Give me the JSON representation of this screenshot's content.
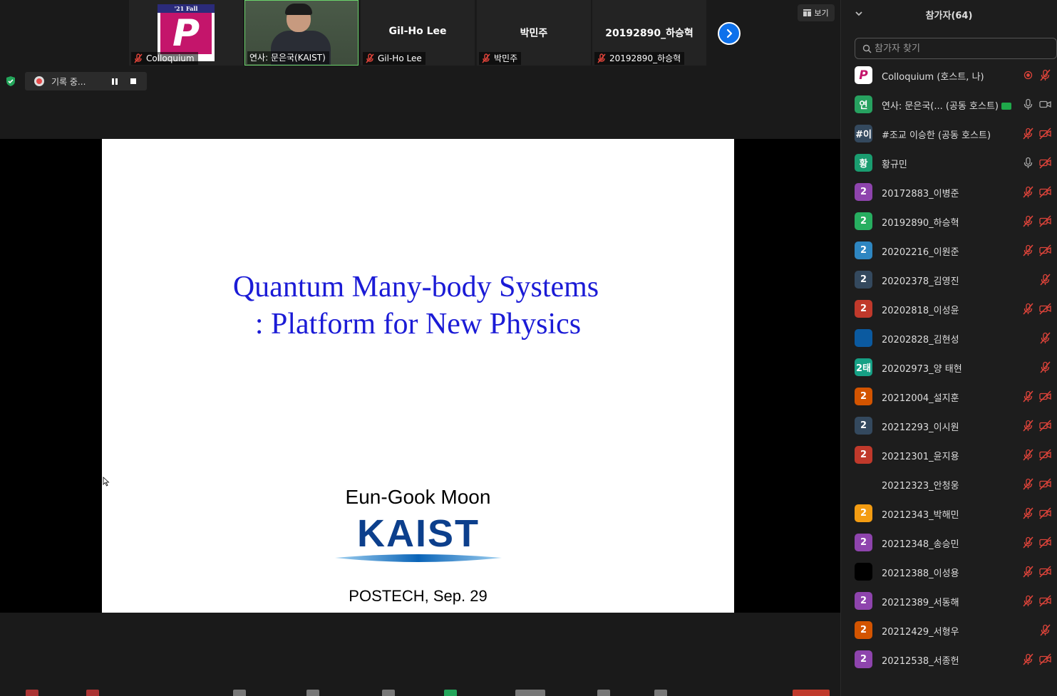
{
  "top_strip": {
    "tiles": [
      {
        "kind": "logo",
        "label": "Colloquium",
        "logo_top_text": "'21 Fall Colloquium",
        "logo_letter": "P"
      },
      {
        "kind": "video",
        "label": "연사: 문은국(KAIST)"
      },
      {
        "kind": "name",
        "name": "Gil-Ho Lee",
        "label": "Gil-Ho Lee"
      },
      {
        "kind": "name",
        "name": "박민주",
        "label": "박민주"
      },
      {
        "kind": "name",
        "name": "20192890_하승혁",
        "label": "20192890_하승혁"
      }
    ],
    "view_button_label": "보기"
  },
  "recording": {
    "label": "기록 중..."
  },
  "slide": {
    "title_line1": "Quantum Many-body Systems",
    "title_line2": ": Platform for New Physics",
    "author": "Eun-Gook Moon",
    "institution_logo_text": "KAIST",
    "venue": "POSTECH, Sep. 29"
  },
  "panel": {
    "title": "참가자(64)",
    "search_placeholder": "참가자 찾기",
    "participants": [
      {
        "name": "Colloquium (호스트, 나)",
        "avatar_text": "P",
        "avatar_color": "#ffffff",
        "icon_a": "record-icon",
        "icon_b": "mic-muted-icon",
        "avatar_kind": "logo"
      },
      {
        "name": "연사: 문은국(...  (공동 호스트)",
        "avatar_text": "연",
        "avatar_color": "#27a160",
        "icon_a": "mic-icon",
        "icon_b": "camera-icon",
        "share": true
      },
      {
        "name": "#조교 이승한 (공동 호스트)",
        "avatar_text": "#이",
        "avatar_color": "#34495e",
        "icon_a": "mic-muted-icon",
        "icon_b": "camera-off-icon"
      },
      {
        "name": "황규민",
        "avatar_text": "황",
        "avatar_color": "#1a9d70",
        "icon_a": "mic-icon",
        "icon_b": "camera-off-icon"
      },
      {
        "name": "20172883_이병준",
        "avatar_text": "2",
        "avatar_color": "#8e44ad",
        "icon_a": "mic-muted-icon",
        "icon_b": "camera-off-icon"
      },
      {
        "name": "20192890_하승혁",
        "avatar_text": "2",
        "avatar_color": "#27ae60",
        "icon_a": "mic-muted-icon",
        "icon_b": "camera-off-icon"
      },
      {
        "name": "20202216_이원준",
        "avatar_text": "2",
        "avatar_color": "#2e86c1",
        "icon_a": "mic-muted-icon",
        "icon_b": "camera-off-icon"
      },
      {
        "name": "20202378_김영진",
        "avatar_text": "2",
        "avatar_color": "#34495e",
        "icon_a": "",
        "icon_b": "mic-muted-icon"
      },
      {
        "name": "20202818_이성윤",
        "avatar_text": "2",
        "avatar_color": "#c0392b",
        "icon_a": "mic-muted-icon",
        "icon_b": "camera-off-icon"
      },
      {
        "name": "20202828_김현성",
        "avatar_text": "",
        "avatar_color": "#0b5aa0",
        "icon_a": "",
        "icon_b": "mic-muted-icon"
      },
      {
        "name": "20202973_양 태현",
        "avatar_text": "2태",
        "avatar_color": "#16a085",
        "icon_a": "",
        "icon_b": "mic-muted-icon"
      },
      {
        "name": "20212004_설지훈",
        "avatar_text": "2",
        "avatar_color": "#d35400",
        "icon_a": "mic-muted-icon",
        "icon_b": "camera-off-icon"
      },
      {
        "name": "20212293_이시원",
        "avatar_text": "2",
        "avatar_color": "#34495e",
        "icon_a": "mic-muted-icon",
        "icon_b": "camera-off-icon"
      },
      {
        "name": "20212301_윤지용",
        "avatar_text": "2",
        "avatar_color": "#c0392b",
        "icon_a": "mic-muted-icon",
        "icon_b": "camera-off-icon"
      },
      {
        "name": "20212323_안청웅",
        "avatar_text": "",
        "avatar_color": "transparent",
        "icon_a": "mic-muted-icon",
        "icon_b": "camera-off-icon"
      },
      {
        "name": "20212343_박해민",
        "avatar_text": "2",
        "avatar_color": "#f39c12",
        "icon_a": "mic-muted-icon",
        "icon_b": "camera-off-icon"
      },
      {
        "name": "20212348_송승민",
        "avatar_text": "2",
        "avatar_color": "#8e44ad",
        "icon_a": "mic-muted-icon",
        "icon_b": "camera-off-icon"
      },
      {
        "name": "20212388_이성용",
        "avatar_text": "",
        "avatar_color": "#000000",
        "icon_a": "mic-muted-icon",
        "icon_b": "camera-off-icon"
      },
      {
        "name": "20212389_서동해",
        "avatar_text": "2",
        "avatar_color": "#8e44ad",
        "icon_a": "mic-muted-icon",
        "icon_b": "camera-off-icon"
      },
      {
        "name": "20212429_서형우",
        "avatar_text": "2",
        "avatar_color": "#d35400",
        "icon_a": "",
        "icon_b": "mic-muted-icon"
      },
      {
        "name": "20212538_서종헌",
        "avatar_text": "2",
        "avatar_color": "#8e44ad",
        "icon_a": "mic-muted-icon",
        "icon_b": "camera-off-icon"
      }
    ]
  }
}
